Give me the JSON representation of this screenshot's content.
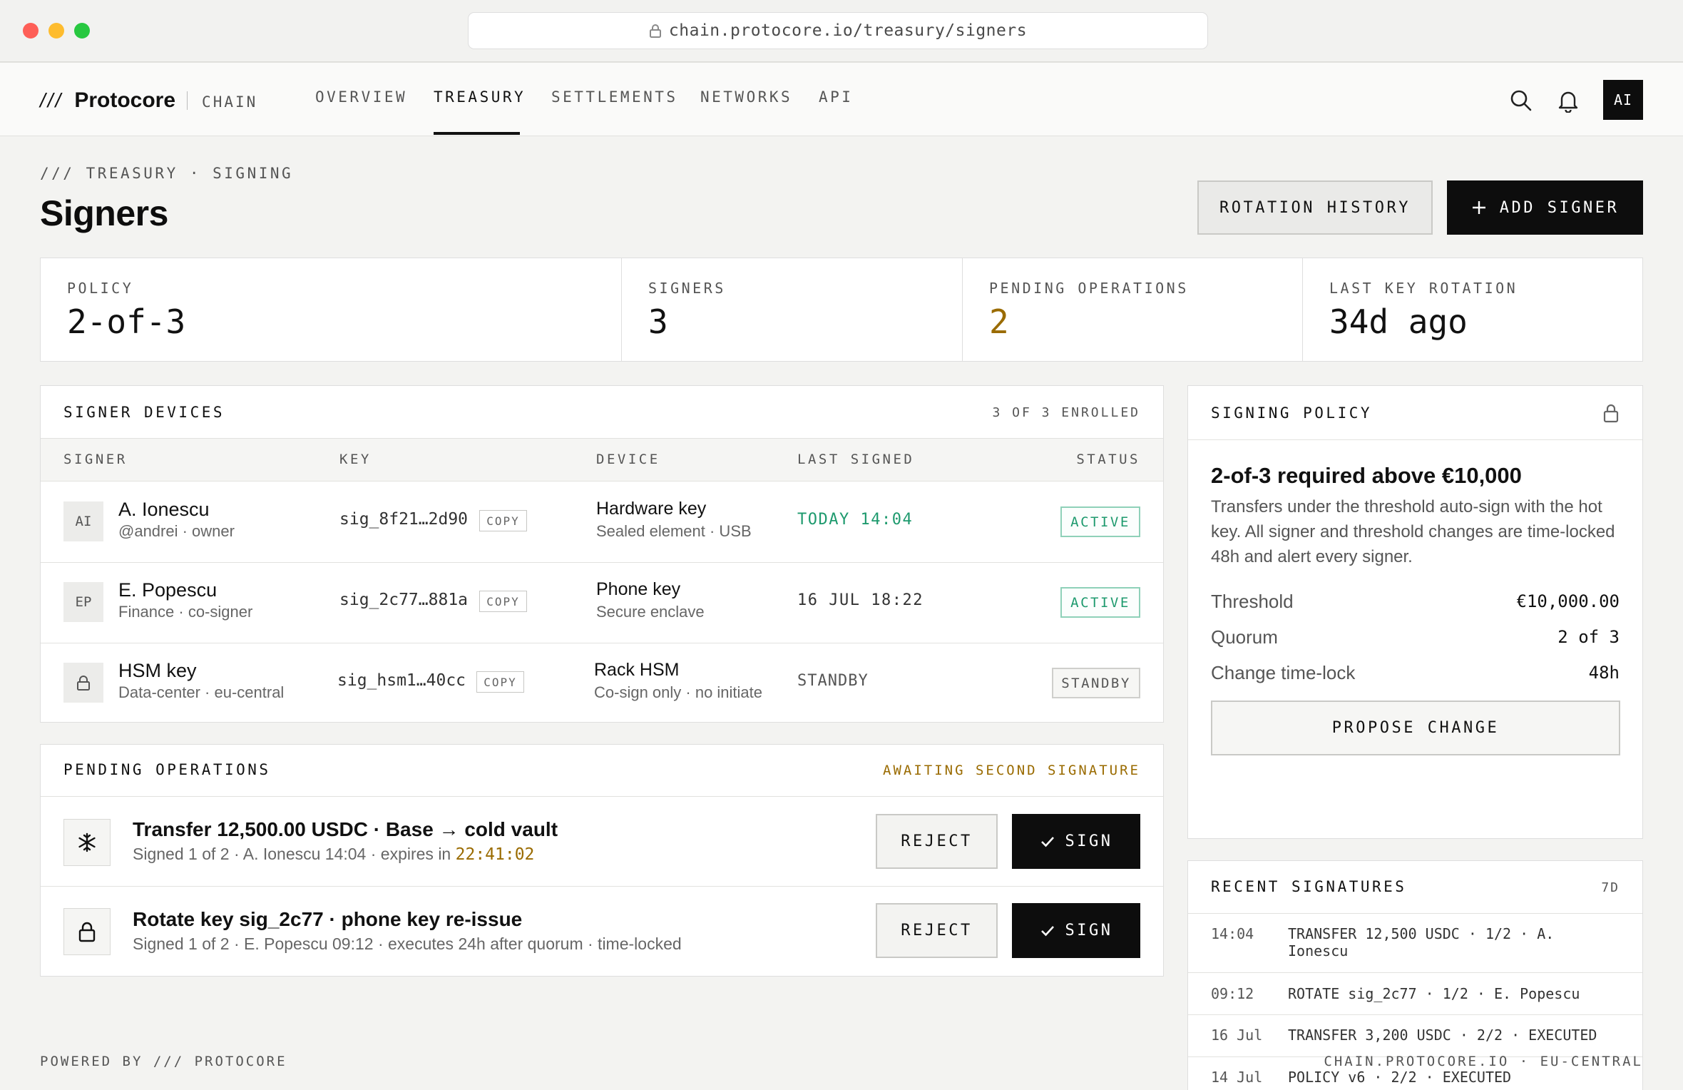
{
  "browser": {
    "url": "chain.protocore.io/treasury/signers"
  },
  "brand": {
    "mark": "///",
    "name": "Protocore",
    "product": "CHAIN"
  },
  "nav": {
    "items": [
      "OVERVIEW",
      "TREASURY",
      "SETTLEMENTS",
      "NETWORKS",
      "API"
    ],
    "active": "TREASURY"
  },
  "user": {
    "initials": "AI"
  },
  "header": {
    "breadcrumb": "/// TREASURY · SIGNING",
    "title": "Signers",
    "rotation_button": "ROTATION HISTORY",
    "add_button": "ADD SIGNER"
  },
  "stats": [
    {
      "label": "POLICY",
      "value": "2-of-3"
    },
    {
      "label": "SIGNERS",
      "value": "3"
    },
    {
      "label": "PENDING OPERATIONS",
      "value": "2"
    },
    {
      "label": "LAST KEY ROTATION",
      "value": "34d ago"
    }
  ],
  "devices": {
    "title": "SIGNER DEVICES",
    "enrolled": "3 OF 3 ENROLLED",
    "columns": [
      "SIGNER",
      "KEY",
      "DEVICE",
      "LAST SIGNED",
      "STATUS"
    ],
    "copy_label": "COPY",
    "rows": [
      {
        "avatar": "AI",
        "name": "A. Ionescu",
        "sub": "@andrei · owner",
        "key": "sig_8f21…2d90",
        "device": "Hardware key",
        "device_sub": "Sealed element · USB",
        "last": "TODAY 14:04",
        "status": "ACTIVE"
      },
      {
        "avatar": "EP",
        "name": "E. Popescu",
        "sub": "Finance · co-signer",
        "key": "sig_2c77…881a",
        "device": "Phone key",
        "device_sub": "Secure enclave",
        "last": "16 JUL 18:22",
        "status": "ACTIVE"
      },
      {
        "avatar": "lock-icon",
        "name": "HSM key",
        "sub": "Data-center · eu-central",
        "key": "sig_hsm1…40cc",
        "device": "Rack HSM",
        "device_sub": "Co-sign only · no initiate",
        "last": "STANDBY",
        "status": "STANDBY"
      }
    ]
  },
  "pending": {
    "title": "PENDING OPERATIONS",
    "status": "AWAITING SECOND SIGNATURE",
    "reject_label": "REJECT",
    "sign_label": "SIGN",
    "items": [
      {
        "icon": "snowflake-icon",
        "title": "Transfer 12,500.00 USDC · Base → cold vault",
        "sub": "Signed 1 of 2 · A. Ionescu 14:04 · expires in ",
        "countdown": "22:41:02"
      },
      {
        "icon": "lock-icon",
        "title": "Rotate key sig_2c77 · phone key re-issue",
        "sub": "Signed 1 of 2 · E. Popescu 09:12 · executes 24h after quorum · time-locked"
      }
    ]
  },
  "policy": {
    "title": "SIGNING POLICY",
    "headline": "2-of-3 required above €10,000",
    "description": "Transfers under the threshold auto-sign with the hot key. All signer and threshold changes are time-locked 48h and alert every signer.",
    "rows": [
      {
        "label": "Threshold",
        "value": "€10,000.00"
      },
      {
        "label": "Quorum",
        "value": "2 of 3"
      },
      {
        "label": "Change time-lock",
        "value": "48h"
      }
    ],
    "button": "PROPOSE CHANGE"
  },
  "recent": {
    "title": "RECENT SIGNATURES",
    "range": "7D",
    "items": [
      {
        "time": "14:04",
        "text": "TRANSFER 12,500 USDC · 1/2 · A. Ionescu"
      },
      {
        "time": "09:12",
        "text": "ROTATE sig_2c77 · 1/2 · E. Popescu"
      },
      {
        "time": "16 Jul",
        "text": "TRANSFER 3,200 USDC · 2/2 · EXECUTED"
      },
      {
        "time": "14 Jul",
        "text": "POLICY v6 · 2/2 · EXECUTED"
      }
    ]
  },
  "footer": {
    "left": "POWERED BY /// PROTOCORE",
    "right": "CHAIN.PROTOCORE.IO · EU-CENTRAL"
  },
  "colors": {
    "accent_gold": "#9a6b00",
    "active_green": "#1e9a6e",
    "dark": "#0d0d0d"
  }
}
